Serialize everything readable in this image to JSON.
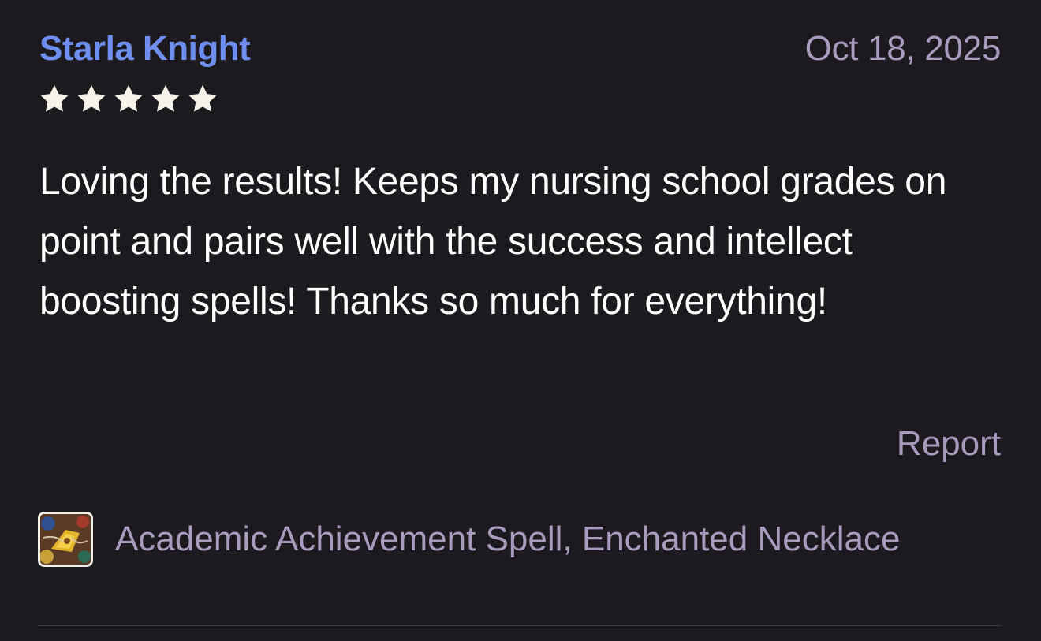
{
  "review": {
    "reviewer_name": "Starla Knight",
    "date": "Oct 18, 2025",
    "rating": 5,
    "rating_max": 5,
    "text": "Loving the results! Keeps my nursing school grades on point and pairs well with the success and intellect boosting spells! Thanks so much for everything!",
    "report_label": "Report",
    "product": {
      "title": "Academic Achievement Spell, Enchanted Necklace",
      "thumbnail_icon": "product-thumbnail-image"
    }
  },
  "colors": {
    "background": "#1c1a1f",
    "reviewer_name": "#6f8ff0",
    "muted_text": "#a99bbd",
    "body_text": "#ffffff",
    "star": "#f5f2ea",
    "divider": "#3d3942"
  },
  "icons": {
    "star": "star-icon"
  }
}
